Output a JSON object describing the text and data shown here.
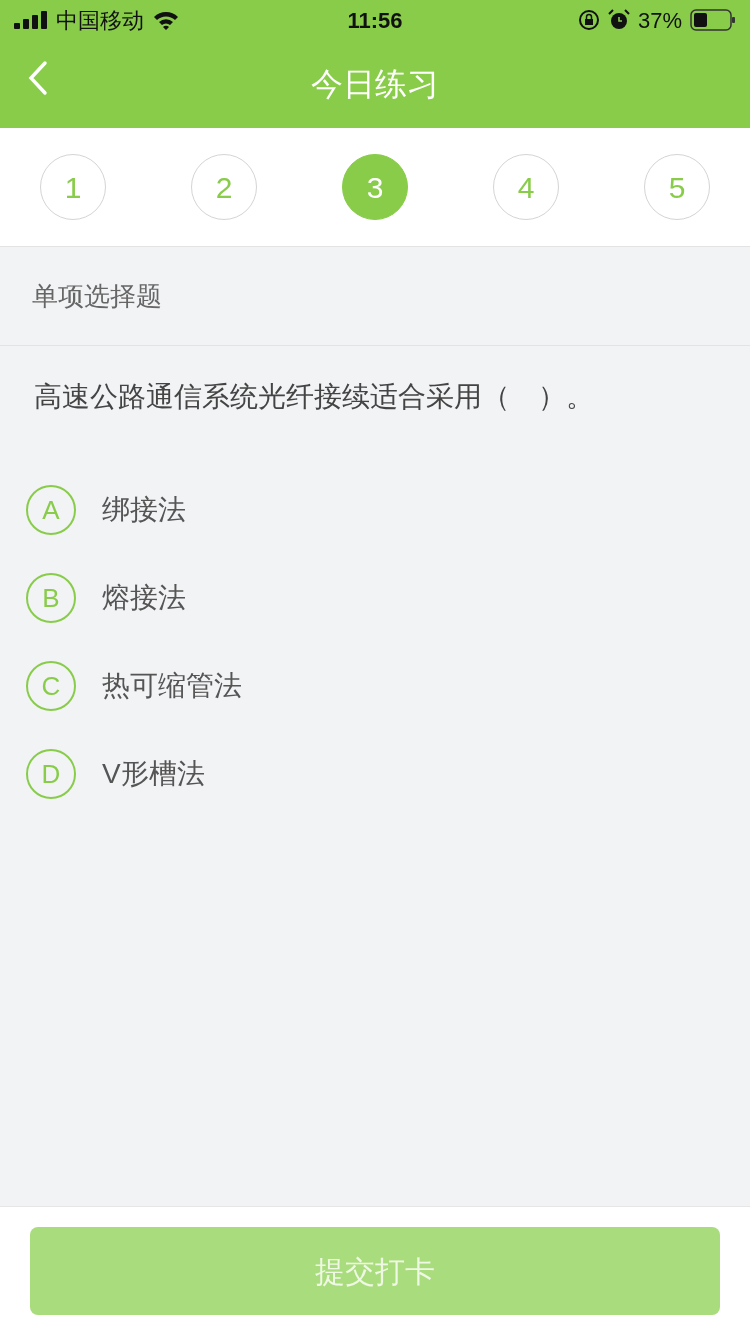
{
  "status_bar": {
    "carrier": "中国移动",
    "time": "11:56",
    "battery": "37%"
  },
  "header": {
    "title": "今日练习"
  },
  "steps": [
    {
      "label": "1",
      "selected": false
    },
    {
      "label": "2",
      "selected": false
    },
    {
      "label": "3",
      "selected": true
    },
    {
      "label": "4",
      "selected": false
    },
    {
      "label": "5",
      "selected": false
    }
  ],
  "question_type": "单项选择题",
  "question": "高速公路通信系统光纤接续适合采用（　）。",
  "options": [
    {
      "letter": "A",
      "text": "绑接法",
      "selected": false
    },
    {
      "letter": "B",
      "text": "熔接法",
      "selected": false
    },
    {
      "letter": "C",
      "text": "热可缩管法",
      "selected": false
    },
    {
      "letter": "D",
      "text": "V形槽法",
      "selected": false
    }
  ],
  "submit": {
    "label": "提交打卡",
    "disabled": true
  }
}
